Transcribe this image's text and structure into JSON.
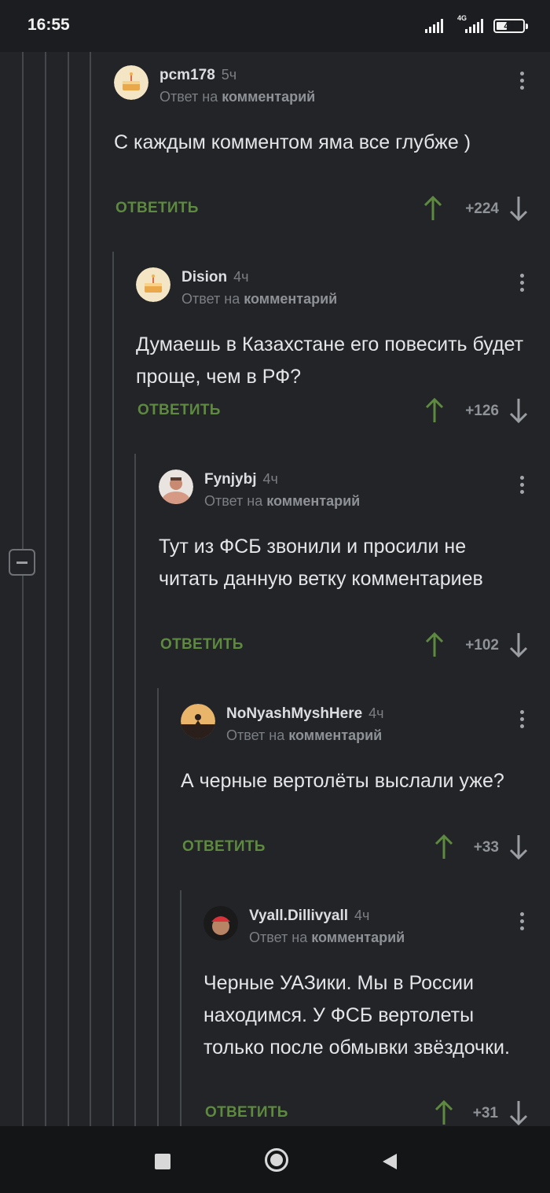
{
  "status_bar": {
    "time": "16:55",
    "network": "4G",
    "battery": "42",
    "battery_level": 0.42
  },
  "comments": [
    {
      "author": "pcm178",
      "time": "5ч",
      "reply_prefix": "Ответ на",
      "reply_link": "комментарий",
      "text": "С каждым комментом яма все глубже )",
      "reply_label": "ОТВЕТИТЬ",
      "score": "+224",
      "avatar_icon": "cake-avatar-icon"
    },
    {
      "author": "Dision",
      "time": "4ч",
      "reply_prefix": "Ответ на",
      "reply_link": "комментарий",
      "text": "Думаешь в Казахстане его повесить будет проще, чем в РФ?",
      "reply_label": "ОТВЕТИТЬ",
      "score": "+126",
      "avatar_icon": "cake-avatar-icon"
    },
    {
      "author": "Fynjybj",
      "time": "4ч",
      "reply_prefix": "Ответ на",
      "reply_link": "комментарий",
      "text": "Тут из ФСБ звонили и просили не читать данную ветку комментариев",
      "reply_label": "ОТВЕТИТЬ",
      "score": "+102",
      "avatar_icon": "person-avatar-icon"
    },
    {
      "author": "NoNyashMyshHere",
      "time": "4ч",
      "reply_prefix": "Ответ на",
      "reply_link": "комментарий",
      "text": "А черные вертолёты выслали уже?",
      "reply_label": "ОТВЕТИТЬ",
      "score": "+33",
      "avatar_icon": "sunset-avatar-icon"
    },
    {
      "author": "Vyall.Dillivyall",
      "time": "4ч",
      "reply_prefix": "Ответ на",
      "reply_link": "комментарий",
      "text": "Черные УАЗики. Мы в России находимся. У ФСБ вертолеты только после обмывки звёздочки.",
      "reply_label": "ОТВЕТИТЬ",
      "score": "+31",
      "avatar_icon": "bandana-avatar-icon"
    }
  ],
  "colors": {
    "background": "#222428",
    "reply_green": "#5d8a3f",
    "upvote_green": "#5d8a3f",
    "downvote_gray": "#9a9da2"
  }
}
